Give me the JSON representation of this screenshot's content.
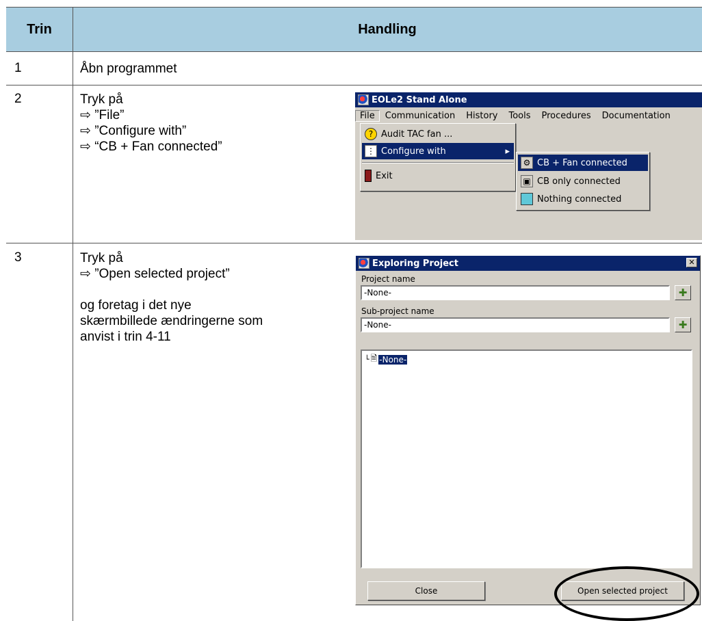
{
  "table": {
    "header": {
      "col1": "Trin",
      "col2": "Handling"
    },
    "rows": [
      {
        "num": "1",
        "lines": [
          "Åbn programmet"
        ]
      },
      {
        "num": "2",
        "lines": [
          "Tryk på",
          "⇨ ”File”",
          "⇨ ”Configure with”",
          "⇨ “CB + Fan connected”"
        ]
      },
      {
        "num": "3",
        "lines": [
          "Tryk på",
          "⇨ ”Open selected project”",
          "",
          "og foretag i det nye",
          "skærmbillede ændringerne som",
          "anvist i trin 4-11"
        ]
      }
    ]
  },
  "screenshot1": {
    "title": "EOLe2 Stand Alone",
    "menu": [
      "File",
      "Communication",
      "History",
      "Tools",
      "Procedures",
      "Documentation"
    ],
    "file_menu": [
      {
        "label": "Audit TAC fan ...",
        "icon": "help-icon"
      },
      {
        "label": "Configure with",
        "icon": "tree-icon"
      },
      {
        "label": "Exit",
        "icon": "exit-icon"
      }
    ],
    "submenu": [
      {
        "label": "CB + Fan connected",
        "icon": "cb-fan-icon"
      },
      {
        "label": "CB only connected",
        "icon": "cb-icon"
      },
      {
        "label": "Nothing connected",
        "icon": "box-icon"
      }
    ]
  },
  "screenshot2": {
    "title": "Exploring Project",
    "close_glyph": "✕",
    "project_label": "Project name",
    "project_value": "-None-",
    "subproject_label": "Sub-project name",
    "subproject_value": "-None-",
    "tree_item": "-None-",
    "close_button": "Close",
    "open_button": "Open selected project"
  }
}
